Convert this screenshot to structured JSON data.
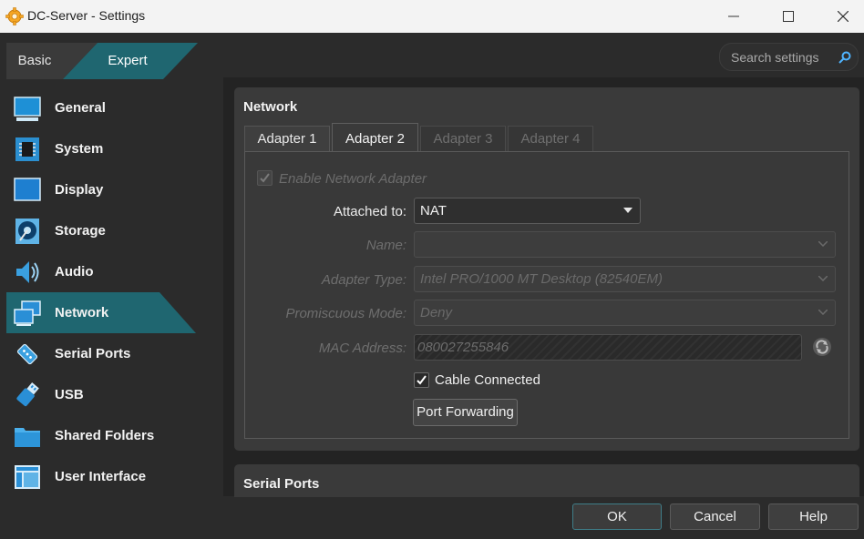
{
  "window": {
    "title": "DC-Server - Settings"
  },
  "mode_toggle": {
    "basic_label": "Basic",
    "expert_label": "Expert"
  },
  "search": {
    "placeholder": "Search settings"
  },
  "sidebar": {
    "items": [
      {
        "label": "General",
        "icon": "general-icon"
      },
      {
        "label": "System",
        "icon": "system-icon"
      },
      {
        "label": "Display",
        "icon": "display-icon"
      },
      {
        "label": "Storage",
        "icon": "storage-icon"
      },
      {
        "label": "Audio",
        "icon": "audio-icon"
      },
      {
        "label": "Network",
        "icon": "network-icon",
        "selected": true
      },
      {
        "label": "Serial Ports",
        "icon": "serial-ports-icon"
      },
      {
        "label": "USB",
        "icon": "usb-icon"
      },
      {
        "label": "Shared Folders",
        "icon": "shared-folders-icon"
      },
      {
        "label": "User Interface",
        "icon": "user-interface-icon"
      }
    ]
  },
  "network": {
    "title": "Network",
    "tabs": [
      {
        "label": "Adapter 1",
        "state": "normal"
      },
      {
        "label": "Adapter 2",
        "state": "active"
      },
      {
        "label": "Adapter 3",
        "state": "disabled"
      },
      {
        "label": "Adapter 4",
        "state": "disabled"
      }
    ],
    "enable_adapter_label": "Enable Network Adapter",
    "enable_adapter_checked": true,
    "attached_to_label": "Attached to:",
    "attached_to_value": "NAT",
    "name_label": "Name:",
    "name_value": "",
    "adapter_type_label": "Adapter Type:",
    "adapter_type_value": "Intel PRO/1000 MT Desktop (82540EM)",
    "promiscuous_label": "Promiscuous Mode:",
    "promiscuous_value": "Deny",
    "mac_label": "MAC Address:",
    "mac_value": "080027255846",
    "cable_connected_label": "Cable Connected",
    "cable_connected_checked": true,
    "port_forwarding_label": "Port Forwarding"
  },
  "serial_ports": {
    "title": "Serial Ports"
  },
  "buttons": {
    "ok": "OK",
    "cancel": "Cancel",
    "help": "Help"
  },
  "colors": {
    "accent_teal": "#1f6670",
    "background": "#2b2b2b",
    "panel": "#3a3a3a"
  }
}
